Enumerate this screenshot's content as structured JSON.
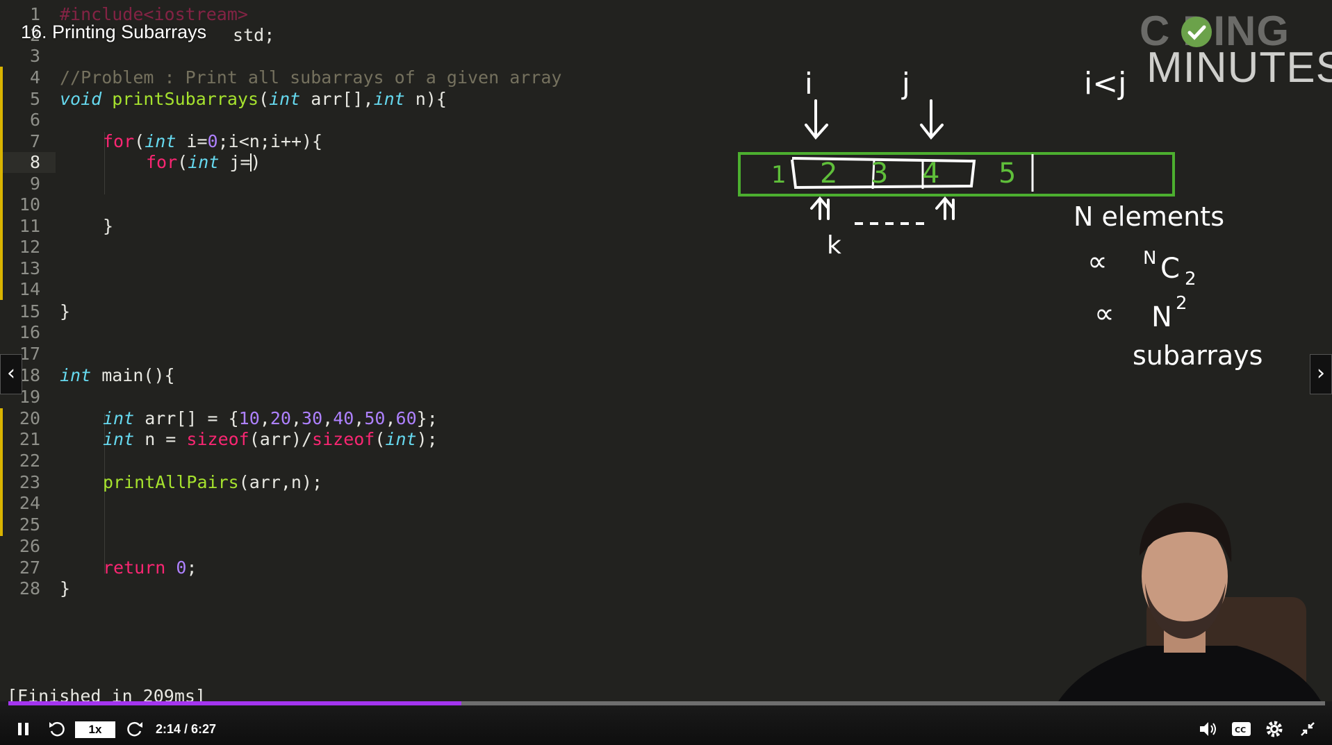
{
  "lecture": {
    "title": "16. Printing Subarrays"
  },
  "editor": {
    "active_line": "8",
    "lines": [
      {
        "num": "1"
      },
      {
        "num": "2"
      },
      {
        "num": "3"
      },
      {
        "num": "4"
      },
      {
        "num": "5"
      },
      {
        "num": "6"
      },
      {
        "num": "7"
      },
      {
        "num": "8"
      },
      {
        "num": "9"
      },
      {
        "num": "10"
      },
      {
        "num": "11"
      },
      {
        "num": "12"
      },
      {
        "num": "13"
      },
      {
        "num": "14"
      },
      {
        "num": "15"
      },
      {
        "num": "16"
      },
      {
        "num": "17"
      },
      {
        "num": "18"
      },
      {
        "num": "19"
      },
      {
        "num": "20"
      },
      {
        "num": "21"
      },
      {
        "num": "22"
      },
      {
        "num": "23"
      },
      {
        "num": "24"
      },
      {
        "num": "25"
      },
      {
        "num": "26"
      },
      {
        "num": "27"
      },
      {
        "num": "28"
      }
    ],
    "code": {
      "l1_pre": "#include<iostream>",
      "l2_tail": " std;",
      "l4_comment": "//Problem : Print all subarrays of a given array",
      "l5_void": "void",
      "l5_fn": "printSubarrays",
      "l5_open": "(",
      "l5_int1": "int",
      "l5_arg1": " arr[],",
      "l5_int2": "int",
      "l5_arg2": " n){",
      "l7_for": "for",
      "l7_open": "(",
      "l7_int": "int",
      "l7_a": " i=",
      "l7_zero": "0",
      "l7_b": ";i<n;i++){",
      "l8_for": "for",
      "l8_open": "(",
      "l8_int": "int",
      "l8_a": " j=",
      "l8_b": ")",
      "l11": "}",
      "l15": "}",
      "l18_int": "int",
      "l18_main": " main(){",
      "l20_int": "int",
      "l20_a": " arr[] = {",
      "l20_v1": "10",
      "l20_v2": "20",
      "l20_v3": "30",
      "l20_v4": "40",
      "l20_v5": "50",
      "l20_v6": "60",
      "l20_comma": ",",
      "l20_end": "};",
      "l21_int": "int",
      "l21_a": " n = ",
      "l21_sz1": "sizeof",
      "l21_b": "(arr)/",
      "l21_sz2": "sizeof",
      "l21_c": "(",
      "l21_int2": "int",
      "l21_d": ");",
      "l23_fn": "printAllPairs",
      "l23_args": "(arr,n);",
      "l27_ret": "return",
      "l27_sp": " ",
      "l27_zero": "0",
      "l27_semi": ";",
      "l28": "}"
    }
  },
  "console": {
    "output": "[Finished in 209ms]"
  },
  "logo": {
    "line1": "C  DING",
    "line2": "MINUTES"
  },
  "whiteboard": {
    "label_i": "i",
    "label_j": "j",
    "condition": "i<j",
    "cells": [
      "1",
      "2",
      "3",
      "4",
      "5"
    ],
    "label_k": "k",
    "note1": "N elements",
    "note2_prefix": "∝",
    "note2_n": "N",
    "note2_c": "C",
    "note2_sub": "2",
    "note3_prefix": "∝",
    "note3_n": "N",
    "note3_sup": "2",
    "note4": "subarrays",
    "colors": {
      "box": "#4caf2f",
      "digits": "#5fbf3a",
      "ink": "#ffffff"
    }
  },
  "player": {
    "progress": 0.344,
    "progress_color": "#a435f0",
    "speed": "1x",
    "time": "2:14 / 6:27",
    "icons": [
      "pause-icon",
      "rewind-icon",
      "forward-icon",
      "volume-icon",
      "captions-icon",
      "settings-icon",
      "exit-fullscreen-icon"
    ]
  },
  "nav": {
    "prev": "‹",
    "next": "›"
  }
}
